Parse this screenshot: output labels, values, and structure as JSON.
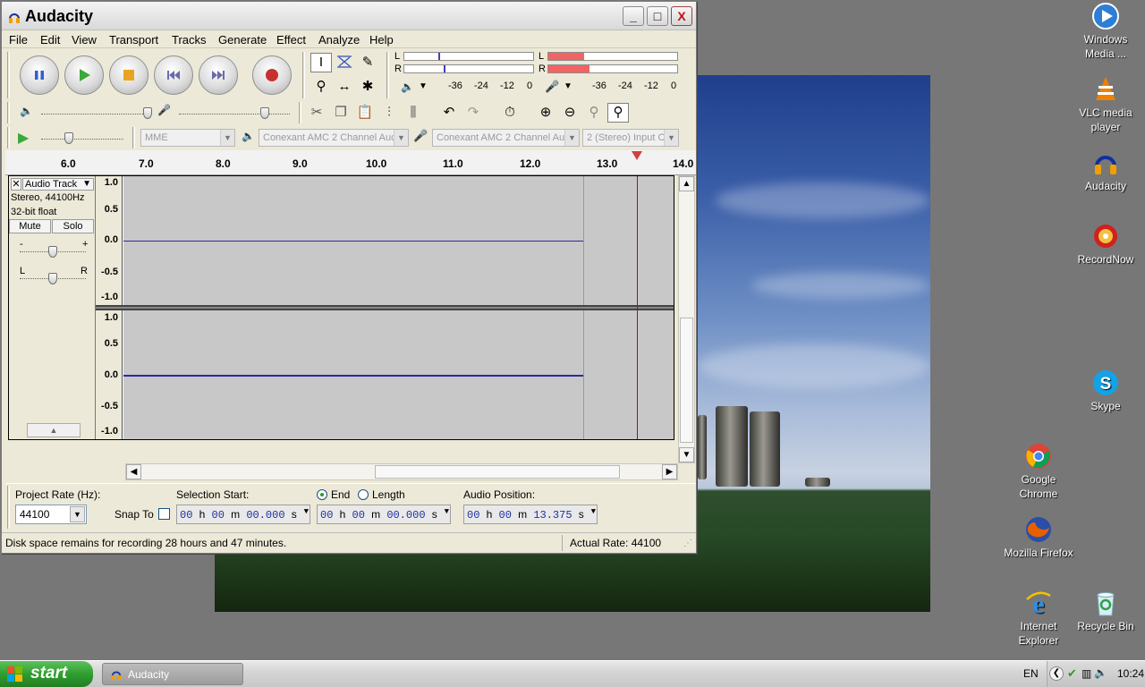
{
  "window": {
    "title": "Audacity",
    "minimize": "_",
    "maximize": "□",
    "close": "X"
  },
  "menu": [
    "File",
    "Edit",
    "View",
    "Transport",
    "Tracks",
    "Generate",
    "Effect",
    "Analyze",
    "Help"
  ],
  "meters": {
    "left_channel": "L",
    "right_channel": "R",
    "play_scale": [
      "-36",
      "-24",
      "-12",
      "0"
    ],
    "record_scale": [
      "-36",
      "-24",
      "-12",
      "0"
    ]
  },
  "device": {
    "host": "MME",
    "output": "Conexant AMC 2 Channel Auc",
    "input": "Conexant AMC 2 Channel Auc",
    "channels": "2 (Stereo) Input C"
  },
  "ruler": {
    "ticks": [
      "6.0",
      "7.0",
      "8.0",
      "9.0",
      "10.0",
      "11.0",
      "12.0",
      "13.0",
      "14.0"
    ]
  },
  "track": {
    "name": "Audio Track",
    "info_format": "Stereo, 44100Hz",
    "info_bits": "32-bit float",
    "mute": "Mute",
    "solo": "Solo",
    "gain_minus": "-",
    "gain_plus": "+",
    "pan_left": "L",
    "pan_right": "R",
    "scale_top": [
      "1.0",
      "0.5",
      "0.0",
      "-0.5",
      "-1.0"
    ],
    "scale_bottom": [
      "1.0",
      "0.5",
      "0.0",
      "-0.5",
      "-1.0"
    ]
  },
  "selection": {
    "project_rate_label": "Project Rate (Hz):",
    "project_rate": "44100",
    "snap_to": "Snap To",
    "selection_start_label": "Selection Start:",
    "end_label": "End",
    "length_label": "Length",
    "audio_position_label": "Audio Position:",
    "start": {
      "h": "00",
      "m": "00",
      "s": "00.000"
    },
    "end": {
      "h": "00",
      "m": "00",
      "s": "00.000"
    },
    "position": {
      "h": "00",
      "m": "00",
      "s": "13.375"
    },
    "unit_h": "h",
    "unit_m": "m",
    "unit_s": "s"
  },
  "status": {
    "disk_space": "Disk space remains for recording 28 hours and 47 minutes.",
    "actual_rate": "Actual Rate: 44100"
  },
  "desktop_icons": [
    {
      "name": "Windows Media ...",
      "icon": "wmp-icon"
    },
    {
      "name": "VLC media player",
      "icon": "vlc-icon"
    },
    {
      "name": "Audacity",
      "icon": "audacity-icon"
    },
    {
      "name": "RecordNow",
      "icon": "recordnow-icon"
    },
    {
      "name": "Skype",
      "icon": "skype-icon"
    },
    {
      "name": "Google Chrome",
      "icon": "chrome-icon"
    },
    {
      "name": "Mozilla Firefox",
      "icon": "firefox-icon"
    },
    {
      "name": "Internet Explorer",
      "icon": "ie-icon"
    },
    {
      "name": "Recycle Bin",
      "icon": "recycle-bin-icon"
    }
  ],
  "taskbar": {
    "start": "start",
    "task": "Audacity",
    "lang": "EN",
    "clock": "10:24"
  },
  "colors": {
    "record_meter": "#f06464",
    "waveform_line": "#2a2aa0",
    "cursor": "#cc0000"
  }
}
